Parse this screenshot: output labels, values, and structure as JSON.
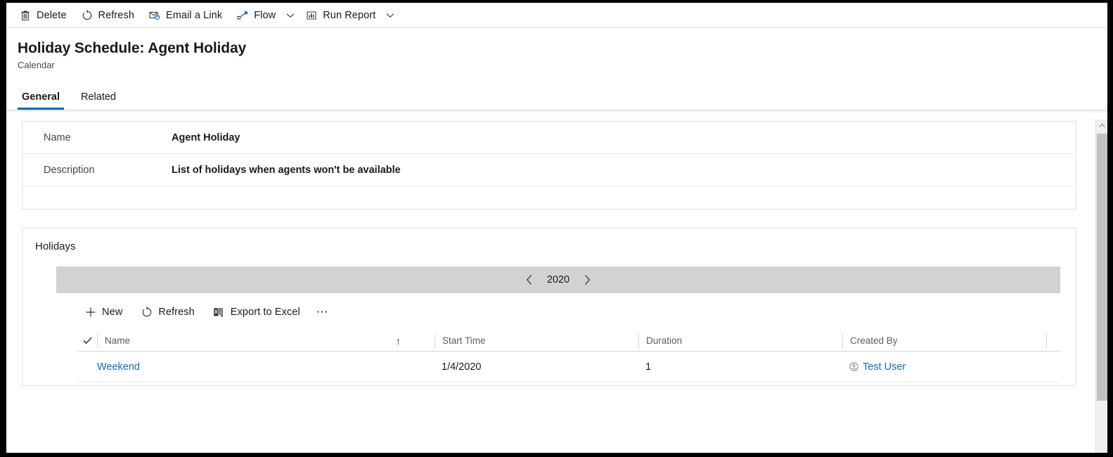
{
  "command_bar": {
    "items": [
      {
        "label": "Delete",
        "icon": "trash-icon",
        "has_caret": false
      },
      {
        "label": "Refresh",
        "icon": "refresh-icon",
        "has_caret": false
      },
      {
        "label": "Email a Link",
        "icon": "email-link-icon",
        "has_caret": false
      },
      {
        "label": "Flow",
        "icon": "flow-icon",
        "has_caret": true
      },
      {
        "label": "Run Report",
        "icon": "report-icon",
        "has_caret": true
      }
    ]
  },
  "header": {
    "title": "Holiday Schedule: Agent Holiday",
    "subtitle": "Calendar",
    "tabs": [
      {
        "label": "General",
        "active": true
      },
      {
        "label": "Related",
        "active": false
      }
    ]
  },
  "general_section": {
    "fields": [
      {
        "label": "Name",
        "value": "Agent Holiday"
      },
      {
        "label": "Description",
        "value": "List of holidays when agents won't be available"
      }
    ]
  },
  "holidays": {
    "title": "Holidays",
    "year_nav": {
      "prev_label": "‹",
      "year": "2020",
      "next_label": "›"
    },
    "commands": [
      {
        "label": "New",
        "icon": "plus-icon"
      },
      {
        "label": "Refresh",
        "icon": "refresh-icon"
      },
      {
        "label": "Export to Excel",
        "icon": "excel-icon"
      }
    ],
    "overflow_label": "⋯",
    "columns": [
      {
        "label": "Name",
        "sort": "↑"
      },
      {
        "label": "Start Time",
        "sort": ""
      },
      {
        "label": "Duration",
        "sort": ""
      },
      {
        "label": "Created By",
        "sort": ""
      }
    ],
    "rows": [
      {
        "name": "Weekend",
        "start_time": "1/4/2020",
        "duration": "1",
        "created_by": "Test User",
        "created_by_icon": "contact-icon"
      }
    ]
  },
  "colors": {
    "accent": "#0f6cbd",
    "link": "#0f6cbd",
    "year_bar": "#d2d2d2",
    "text": "#1b1a19",
    "muted": "#605e5c"
  }
}
